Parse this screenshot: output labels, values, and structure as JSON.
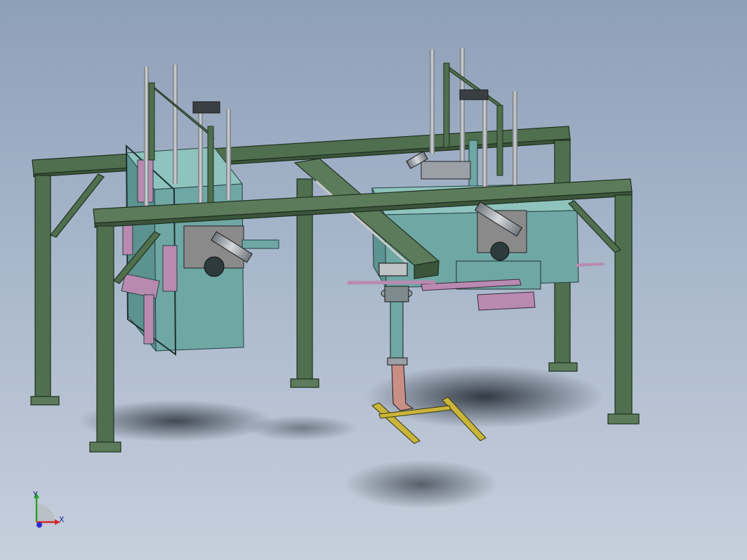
{
  "viewport": {
    "background_top": "#8e9fb8",
    "background_bottom": "#c6cfdc"
  },
  "model_colors": {
    "frame": "#4f6f4e",
    "frame_edge": "#1f2f1f",
    "hopper": "#6fa7a4",
    "hopper_top": "#8fc3bd",
    "bracket": "#b98ab0",
    "cylinder": "#9aa0a6",
    "rail": "#c9b53a",
    "chute": "#c98f85"
  },
  "triad": {
    "x_label": "X",
    "y_label": "Y",
    "z_label": "",
    "x_color": "#d62828",
    "y_color": "#2aa52a",
    "z_color": "#2a2ad6"
  }
}
